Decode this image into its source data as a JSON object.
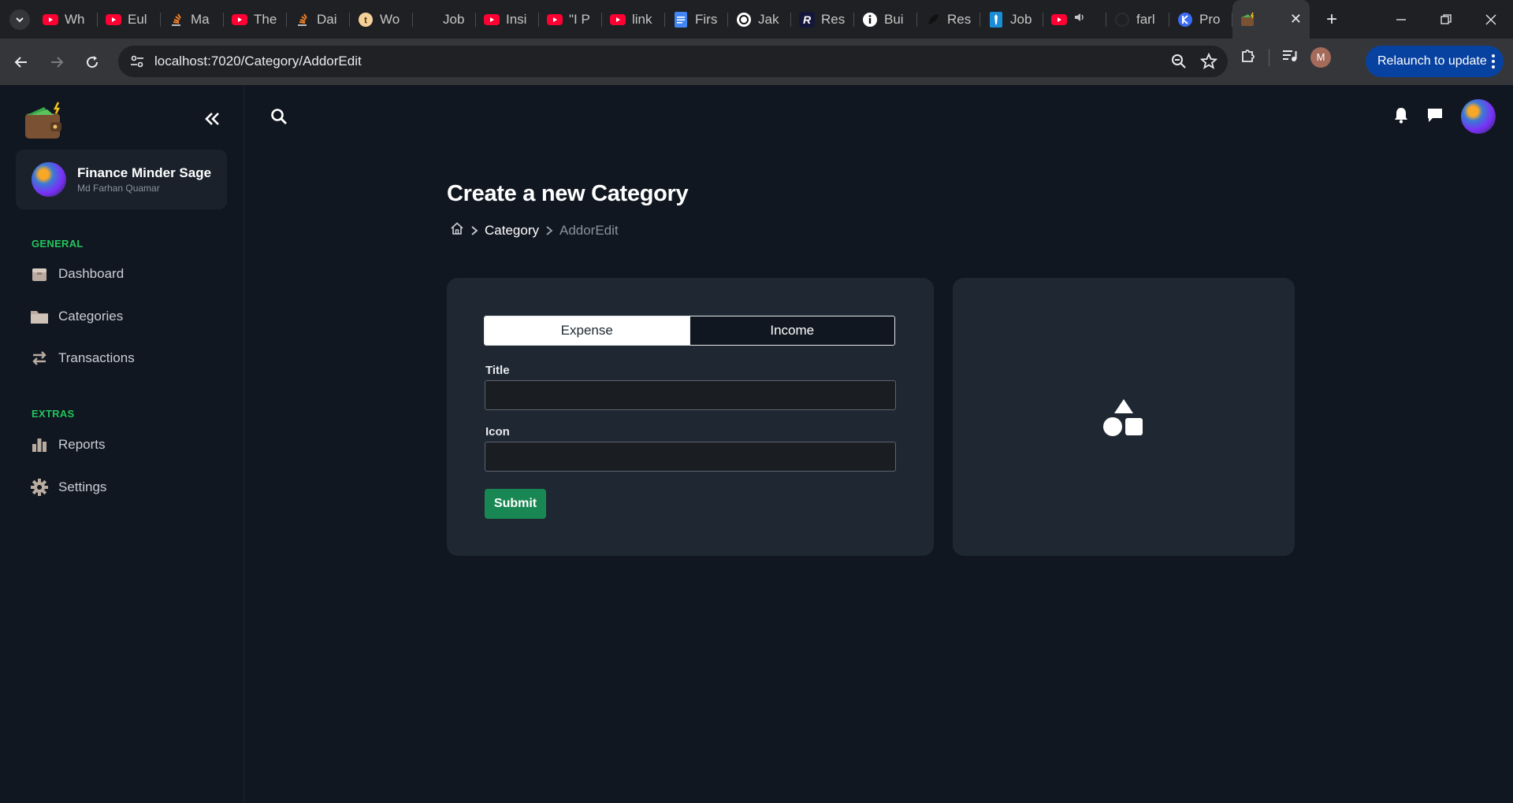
{
  "browser": {
    "tabs": [
      {
        "title": "Wh",
        "icon": "youtube-icon"
      },
      {
        "title": "Eul",
        "icon": "youtube-icon"
      },
      {
        "title": "Ma",
        "icon": "stackoverflow-icon"
      },
      {
        "title": "The",
        "icon": "youtube-icon"
      },
      {
        "title": "Dai",
        "icon": "stackoverflow-icon"
      },
      {
        "title": "Wo",
        "icon": "bitcoin-icon"
      },
      {
        "title": "Job",
        "icon": "blank-icon"
      },
      {
        "title": "Insi",
        "icon": "youtube-icon"
      },
      {
        "title": "\"I P",
        "icon": "youtube-icon"
      },
      {
        "title": "link",
        "icon": "youtube-icon"
      },
      {
        "title": "Firs",
        "icon": "docs-icon"
      },
      {
        "title": "Jak",
        "icon": "chatgpt-icon"
      },
      {
        "title": "Res",
        "icon": "r-icon"
      },
      {
        "title": "Bui",
        "icon": "info-icon"
      },
      {
        "title": "Res",
        "icon": "feather-icon"
      },
      {
        "title": "Job",
        "icon": "tie-icon"
      },
      {
        "title": "",
        "icon": "youtube-audio-icon"
      },
      {
        "title": "farl",
        "icon": "github-icon"
      },
      {
        "title": "Pro",
        "icon": "blue-logo-icon"
      }
    ],
    "active_tab_close": "✕",
    "url": "localhost:7020/Category/AddorEdit",
    "profile_initial": "M",
    "relaunch_label": "Relaunch to update"
  },
  "sidebar": {
    "app_name": "Finance Minder Sage",
    "user_name": "Md Farhan Quamar",
    "sections": [
      {
        "label": "GENERAL",
        "items": [
          {
            "label": "Dashboard",
            "icon": "dashboard-box-icon"
          },
          {
            "label": "Categories",
            "icon": "folder-icon"
          },
          {
            "label": "Transactions",
            "icon": "swap-arrows-icon"
          }
        ]
      },
      {
        "label": "EXTRAS",
        "items": [
          {
            "label": "Reports",
            "icon": "bar-chart-icon"
          },
          {
            "label": "Settings",
            "icon": "gear-icon"
          }
        ]
      }
    ]
  },
  "page": {
    "title": "Create a new Category",
    "breadcrumb": [
      "Category",
      "AddorEdit"
    ]
  },
  "form": {
    "type_options": [
      "Expense",
      "Income"
    ],
    "selected_type": "Expense",
    "title_label": "Title",
    "title_value": "",
    "icon_label": "Icon",
    "icon_value": "",
    "submit_label": "Submit"
  },
  "colors": {
    "background": "#111720",
    "card": "#1f2832",
    "section_accent": "#22c55e",
    "submit": "#198754"
  }
}
